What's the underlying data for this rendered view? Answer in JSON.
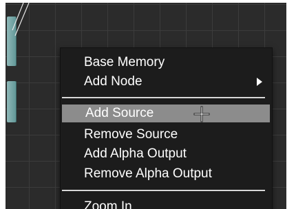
{
  "context_menu": {
    "items": [
      {
        "label": "Base Memory"
      },
      {
        "label": "Add Node",
        "submenu": true
      },
      {
        "label": "Add Source",
        "highlighted": true
      },
      {
        "label": "Remove Source"
      },
      {
        "label": "Add Alpha Output"
      },
      {
        "label": "Remove Alpha Output"
      },
      {
        "label": "Zoom In"
      }
    ]
  },
  "colors": {
    "canvas_background": "#2b2b2b",
    "grid_line": "#3c3c3c",
    "menu_background": "#1c1c1c",
    "menu_highlight": "#8c8c8c",
    "node_accent": "#7fadad"
  },
  "cursor": {
    "icon": "crosshair-cursor-icon"
  }
}
